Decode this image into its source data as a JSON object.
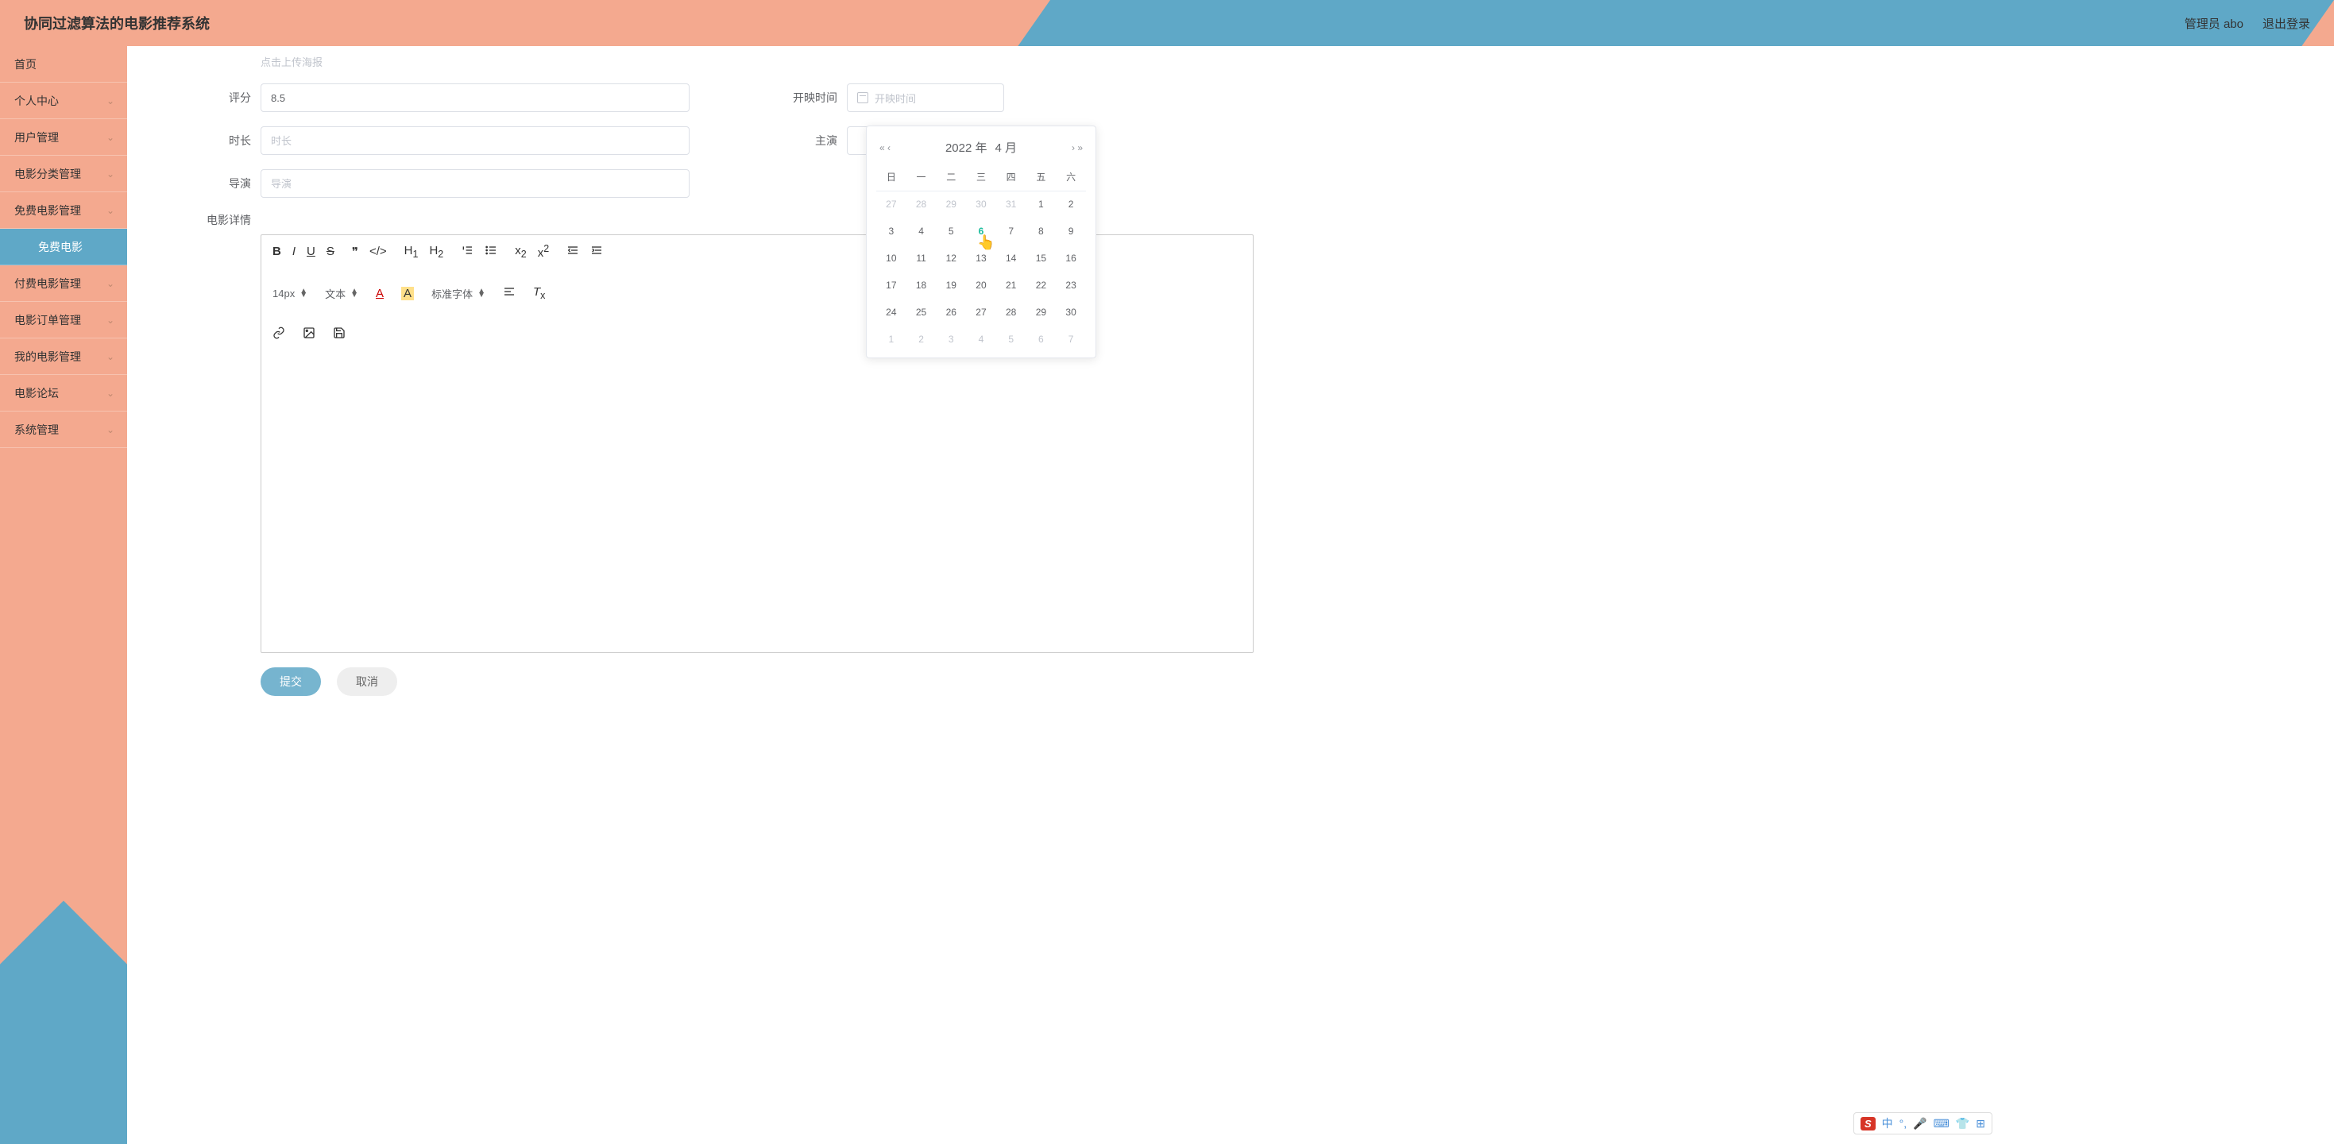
{
  "header": {
    "title": "协同过滤算法的电影推荐系统",
    "admin_label": "管理员 abo",
    "logout_label": "退出登录"
  },
  "sidebar": {
    "items": [
      {
        "label": "首页",
        "expandable": false
      },
      {
        "label": "个人中心",
        "expandable": true
      },
      {
        "label": "用户管理",
        "expandable": true
      },
      {
        "label": "电影分类管理",
        "expandable": true
      },
      {
        "label": "免费电影管理",
        "expandable": true
      },
      {
        "label": "免费电影",
        "expandable": false,
        "active": true
      },
      {
        "label": "付费电影管理",
        "expandable": true
      },
      {
        "label": "电影订单管理",
        "expandable": true
      },
      {
        "label": "我的电影管理",
        "expandable": true
      },
      {
        "label": "电影论坛",
        "expandable": true
      },
      {
        "label": "系统管理",
        "expandable": true
      }
    ]
  },
  "form": {
    "upload_hint": "点击上传海报",
    "rating_label": "评分",
    "rating_value": "8.5",
    "open_label": "开映时间",
    "open_placeholder": "开映时间",
    "duration_label": "时长",
    "duration_placeholder": "时长",
    "actor_label": "主演",
    "director_label": "导演",
    "director_placeholder": "导演",
    "detail_label": "电影详情",
    "submit_label": "提交",
    "cancel_label": "取消"
  },
  "editor": {
    "font_size": "14px",
    "block_type": "文本",
    "font_family": "标准字体"
  },
  "datepicker": {
    "year": "2022 年",
    "month": "4 月",
    "weekdays": [
      "日",
      "一",
      "二",
      "三",
      "四",
      "五",
      "六"
    ],
    "rows": [
      [
        {
          "d": "27",
          "o": true
        },
        {
          "d": "28",
          "o": true
        },
        {
          "d": "29",
          "o": true
        },
        {
          "d": "30",
          "o": true
        },
        {
          "d": "31",
          "o": true
        },
        {
          "d": "1"
        },
        {
          "d": "2"
        }
      ],
      [
        {
          "d": "3"
        },
        {
          "d": "4"
        },
        {
          "d": "5"
        },
        {
          "d": "6",
          "today": true
        },
        {
          "d": "7"
        },
        {
          "d": "8"
        },
        {
          "d": "9"
        }
      ],
      [
        {
          "d": "10"
        },
        {
          "d": "11"
        },
        {
          "d": "12"
        },
        {
          "d": "13"
        },
        {
          "d": "14"
        },
        {
          "d": "15"
        },
        {
          "d": "16"
        }
      ],
      [
        {
          "d": "17"
        },
        {
          "d": "18"
        },
        {
          "d": "19"
        },
        {
          "d": "20"
        },
        {
          "d": "21"
        },
        {
          "d": "22"
        },
        {
          "d": "23"
        }
      ],
      [
        {
          "d": "24"
        },
        {
          "d": "25"
        },
        {
          "d": "26"
        },
        {
          "d": "27"
        },
        {
          "d": "28"
        },
        {
          "d": "29"
        },
        {
          "d": "30"
        }
      ],
      [
        {
          "d": "1",
          "o": true
        },
        {
          "d": "2",
          "o": true
        },
        {
          "d": "3",
          "o": true
        },
        {
          "d": "4",
          "o": true
        },
        {
          "d": "5",
          "o": true
        },
        {
          "d": "6",
          "o": true
        },
        {
          "d": "7",
          "o": true
        }
      ]
    ]
  },
  "ime": {
    "logo": "S",
    "lang": "中"
  }
}
